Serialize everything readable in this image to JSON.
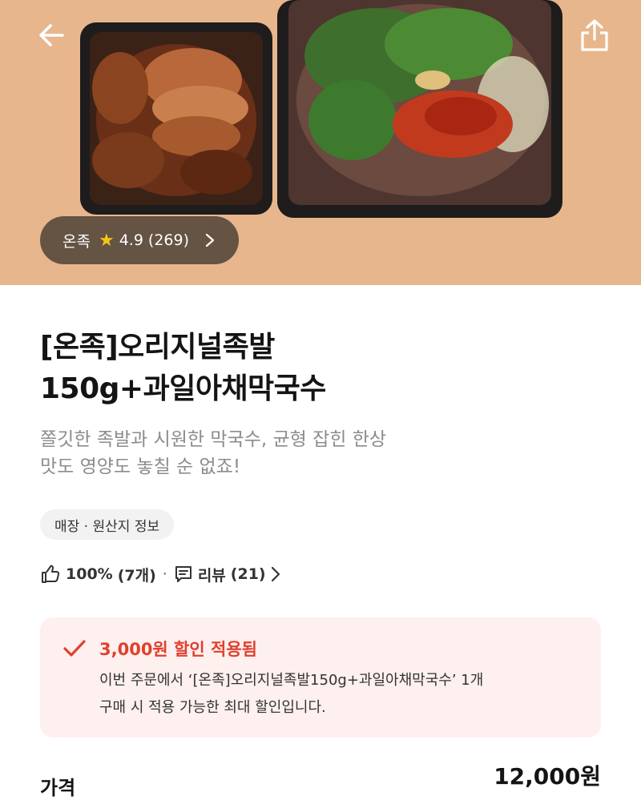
{
  "hero": {
    "image_description_name": "product-photo",
    "back_icon": "arrow-left-icon",
    "share_icon": "share-icon",
    "store": {
      "name": "온족",
      "rating": "4.9",
      "review_count": "(269)"
    }
  },
  "product": {
    "title_line1": "[온족]오리지널족발",
    "title_line2": "150g+과일아채막국수",
    "subtitle_line1": "쫄깃한 족발과 시원한 막국수, 균형 잡힌 한상",
    "subtitle_line2": "맛도 영양도 놓칠 순 없죠!",
    "info_chip": "매장 · 원산지 정보"
  },
  "stats": {
    "like_percent": "100%",
    "like_count": "(7개)",
    "separator": "·",
    "review_label": "리뷰",
    "review_count": "(21)"
  },
  "discount": {
    "title": "3,000원 할인 적용됨",
    "desc_line1": "이번 주문에서 ‘[온족]오리지널족발150g+과일아채막국수’ 1개",
    "desc_line2": "구매 시 적용 가능한 최대 할인입니다.",
    "accent_color": "#e0402e",
    "background_color": "#fdf0ee"
  },
  "price": {
    "label": "가격",
    "value": "12,000원"
  }
}
